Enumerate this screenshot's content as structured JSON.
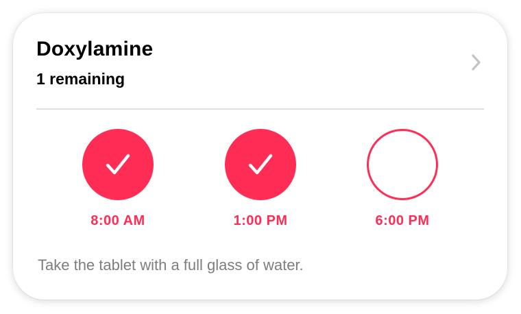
{
  "medication": {
    "name": "Doxylamine",
    "remaining": "1 remaining",
    "instructions": "Take the tablet with a full glass of water."
  },
  "doses": [
    {
      "time": "8:00 AM",
      "status": "taken",
      "icon": "checkmark-icon"
    },
    {
      "time": "1:00 PM",
      "status": "taken",
      "icon": "checkmark-icon"
    },
    {
      "time": "6:00 PM",
      "status": "pending",
      "icon": "empty-circle-icon"
    }
  ],
  "colors": {
    "accent": "#ff2d55",
    "divider": "#dedede",
    "secondary_text": "#7d7d7d",
    "chevron": "#c4c4c6"
  },
  "icons": {
    "disclosure": "chevron-right-icon"
  }
}
